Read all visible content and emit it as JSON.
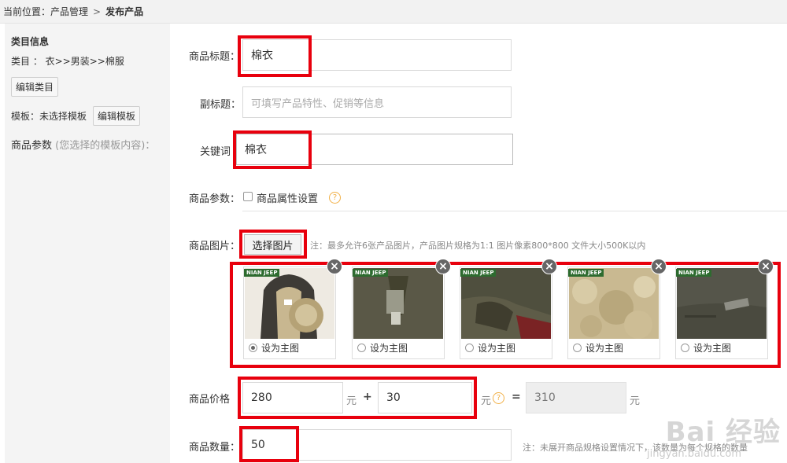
{
  "breadcrumb": {
    "prefix": "当前位置：",
    "sep": ">",
    "level1": "产品管理",
    "level2": "发布产品"
  },
  "sidebar": {
    "title": "类目信息",
    "category": "类目 ： 衣>>男装>>棉服",
    "edit_category_label": "编辑类目",
    "template_text": "模板：未选择模板",
    "edit_template_label": "编辑模板",
    "params_label": "商品参数",
    "params_hint": "(您选择的模板内容)："
  },
  "form": {
    "title_label": "商品标题：",
    "title_value": "棉衣",
    "subtitle_label": "副标题：",
    "subtitle_placeholder": "可填写产品特性、促销等信息",
    "keyword_label": "关键词",
    "keyword_value": "棉衣",
    "params_label": "商品参数：",
    "params_checkbox_label": "商品属性设置",
    "images_label": "商品图片：",
    "choose_image_label": "选择图片",
    "images_note": "注：最多允许6张产品图片，产品图片规格为1:1 图片像素800*800 文件大小500K以内",
    "thumbnails": [
      {
        "brand": "NIAN JEEP",
        "set_main": "设为主图",
        "selected": true,
        "icon": "jacket-front-image"
      },
      {
        "brand": "NIAN JEEP",
        "set_main": "设为主图",
        "selected": false,
        "icon": "zipper-closeup-image"
      },
      {
        "brand": "NIAN JEEP",
        "set_main": "设为主图",
        "selected": false,
        "icon": "sleeve-closeup-image"
      },
      {
        "brand": "NIAN JEEP",
        "set_main": "设为主图",
        "selected": false,
        "icon": "fleece-lining-image"
      },
      {
        "brand": "NIAN JEEP",
        "set_main": "设为主图",
        "selected": false,
        "icon": "pocket-closeup-image"
      }
    ],
    "price_label": "商品价格",
    "price_value": "280",
    "price_unit": "元",
    "plus": "+",
    "extra_value": "30",
    "extra_unit": "元",
    "equals": "=",
    "total_value": "310",
    "total_unit": "元",
    "qty_label": "商品数量：",
    "qty_value": "50",
    "qty_note": "注：未展开商品规格设置情况下，该数量为每个规格的数量"
  },
  "watermark": {
    "brand": "Bai 经验",
    "url": "jingyan.baidu.com"
  },
  "colors": {
    "highlight": "#e8000d",
    "sidebar_bg": "#f4f4f4",
    "brand_tag": "#2d6b2f",
    "help_icon": "#f1b047"
  }
}
